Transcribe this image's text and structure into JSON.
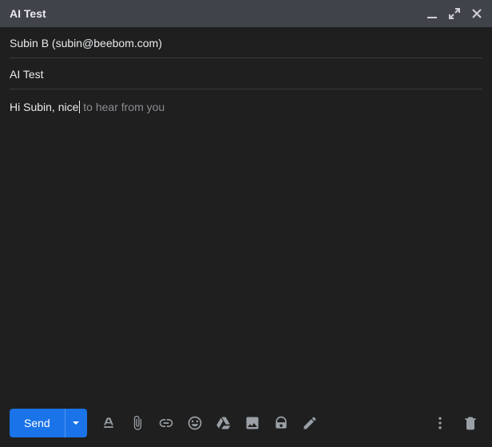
{
  "header": {
    "title": "AI Test"
  },
  "fields": {
    "to": "Subin B (subin@beebom.com)",
    "subject": "AI Test"
  },
  "body": {
    "typed": "Hi Subin, nice",
    "suggestion": " to hear from you"
  },
  "footer": {
    "send_label": "Send"
  },
  "colors": {
    "accent": "#1a73e8",
    "bg": "#1f1f1f",
    "header_bg": "#41434b",
    "icon": "#9aa0a6"
  }
}
